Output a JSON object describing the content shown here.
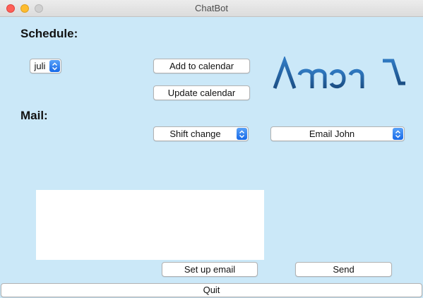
{
  "window": {
    "title": "ChatBot"
  },
  "schedule": {
    "heading": "Schedule:",
    "month_selected": "juli",
    "add_label": "Add to calendar",
    "update_label": "Update calendar"
  },
  "logo": {
    "text": "AmphiA",
    "color": "#2e6fb0"
  },
  "mail": {
    "heading": "Mail:",
    "template_selected": "Shift change",
    "recipient_selected": "Email John",
    "body_text": "",
    "setup_label": "Set up email",
    "send_label": "Send"
  },
  "footer": {
    "quit_label": "Quit"
  },
  "colors": {
    "background": "#cbe8f8",
    "accent": "#1769e8"
  }
}
